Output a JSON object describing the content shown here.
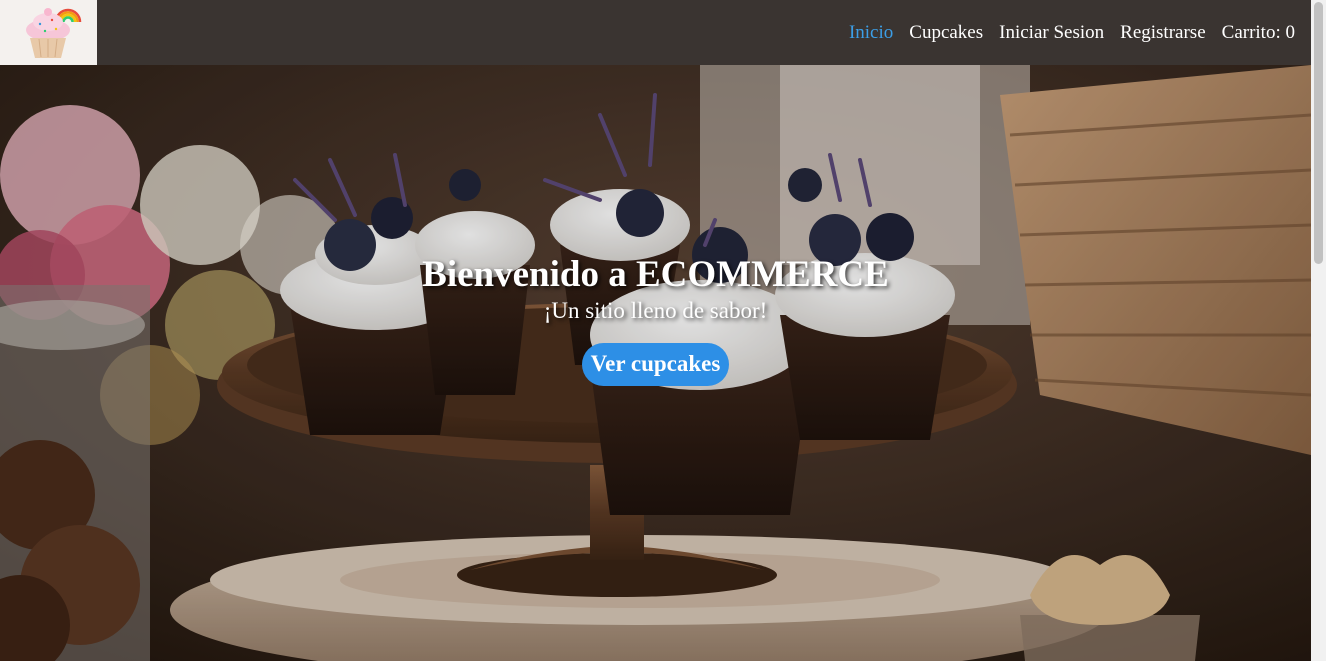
{
  "logo": {
    "alt": "Cupcake logo",
    "icon": "cupcake-rainbow-icon"
  },
  "nav": {
    "items": [
      {
        "label": "Inicio",
        "active": true
      },
      {
        "label": "Cupcakes",
        "active": false
      },
      {
        "label": "Iniciar Sesion",
        "active": false
      },
      {
        "label": "Registrarse",
        "active": false
      },
      {
        "label": "Carrito: 0",
        "active": false
      }
    ]
  },
  "hero": {
    "title": "Bienvenido a ECOMMERCE",
    "subtitle": "¡Un sitio lleno de sabor!",
    "button_label": "Ver cupcakes"
  },
  "colors": {
    "navbar": "#3a3431",
    "active_link": "#3c9ee6",
    "button": "#2d8fe6",
    "text": "#ffffff"
  }
}
